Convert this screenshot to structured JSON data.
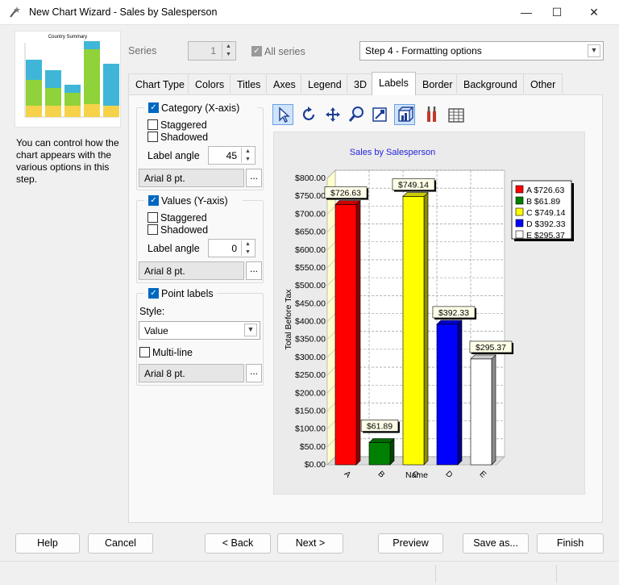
{
  "window": {
    "title": "New Chart Wizard - Sales by Salesperson",
    "min": "—",
    "max": "☐",
    "close": "✕"
  },
  "thumbnail_title": "Country Summary",
  "help_text": "You can control how the chart appears with the various options in this step.",
  "series": {
    "label": "Series",
    "value": "1",
    "all_label": "All series"
  },
  "step_select": {
    "value": "Step 4 - Formatting options"
  },
  "tabs": [
    "Chart Type",
    "Colors",
    "Titles",
    "Axes",
    "Legend",
    "3D",
    "Labels",
    "Border",
    "Background",
    "Other"
  ],
  "active_tab": "Labels",
  "category": {
    "label": "Category (X-axis)",
    "staggered": "Staggered",
    "shadowed": "Shadowed",
    "angle_label": "Label angle",
    "angle": "45",
    "font": "Arial 8 pt."
  },
  "values_axis": {
    "label": "Values (Y-axis)",
    "staggered": "Staggered",
    "shadowed": "Shadowed",
    "angle_label": "Label angle",
    "angle": "0",
    "font": "Arial 8 pt."
  },
  "point_labels": {
    "label": "Point labels",
    "style_label": "Style:",
    "style": "Value",
    "multiline": "Multi-line",
    "font": "Arial 8 pt."
  },
  "dots": "...",
  "toolbar": [
    "pointer-icon",
    "rotate-icon",
    "move-icon",
    "zoom-icon",
    "chart-edit-icon",
    "3d-toggle-icon",
    "tools-icon",
    "data-grid-icon"
  ],
  "buttons": {
    "help": "Help",
    "cancel": "Cancel",
    "back": "< Back",
    "next": "Next >",
    "preview": "Preview",
    "saveas": "Save as...",
    "finish": "Finish"
  },
  "chart_data": {
    "type": "bar",
    "title": "Sales by Salesperson",
    "xlabel": "Name",
    "ylabel": "Total Before Tax",
    "categories": [
      "A",
      "B",
      "C",
      "D",
      "E"
    ],
    "values": [
      726.63,
      61.89,
      749.14,
      392.33,
      295.37
    ],
    "point_labels": [
      "$726.63",
      "$61.89",
      "$749.14",
      "$392.33",
      "$295.37"
    ],
    "colors": [
      "#ff0000",
      "#008000",
      "#ffff00",
      "#0000ff",
      "#ffffff"
    ],
    "ylim": [
      0,
      800
    ],
    "yticks": [
      "$0.00",
      "$50.00",
      "$100.00",
      "$150.00",
      "$200.00",
      "$250.00",
      "$300.00",
      "$350.00",
      "$400.00",
      "$450.00",
      "$500.00",
      "$550.00",
      "$600.00",
      "$650.00",
      "$700.00",
      "$750.00",
      "$800.00"
    ],
    "legend": [
      "A $726.63",
      "B $61.89",
      "C $749.14",
      "D $392.33",
      "E $295.37"
    ],
    "legend_position": "right",
    "grid": true
  }
}
